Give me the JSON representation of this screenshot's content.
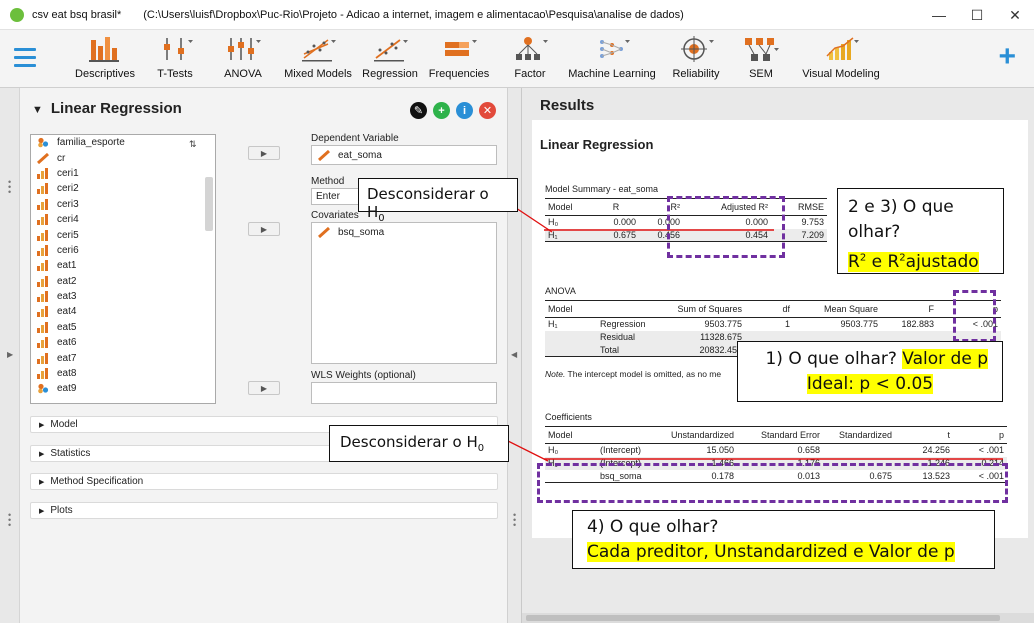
{
  "window": {
    "title": "csv eat bsq brasil*",
    "path": "(C:\\Users\\luisf\\Dropbox\\Puc-Rio\\Projeto - Adicao a internet, imagem e alimentacao\\Pesquisa\\analise de dados)"
  },
  "ribbon": {
    "items": [
      {
        "label": "Descriptives",
        "icon": "descriptives-icon"
      },
      {
        "label": "T-Tests",
        "icon": "ttests-icon"
      },
      {
        "label": "ANOVA",
        "icon": "anova-icon"
      },
      {
        "label": "Mixed Models",
        "icon": "mixed-models-icon"
      },
      {
        "label": "Regression",
        "icon": "regression-icon"
      },
      {
        "label": "Frequencies",
        "icon": "frequencies-icon"
      },
      {
        "label": "Factor",
        "icon": "factor-icon"
      },
      {
        "label": "Machine Learning",
        "icon": "machine-learning-icon"
      },
      {
        "label": "Reliability",
        "icon": "reliability-icon"
      },
      {
        "label": "SEM",
        "icon": "sem-icon"
      },
      {
        "label": "Visual Modeling",
        "icon": "visual-modeling-icon"
      }
    ]
  },
  "analysis": {
    "title": "Linear Regression",
    "variables": [
      "familia_esporte",
      "cr",
      "ceri1",
      "ceri2",
      "ceri3",
      "ceri4",
      "ceri5",
      "ceri6",
      "eat1",
      "eat2",
      "eat3",
      "eat4",
      "eat5",
      "eat6",
      "eat7",
      "eat8",
      "eat9"
    ],
    "dependent_label": "Dependent Variable",
    "dependent_value": "eat_soma",
    "method_label": "Method",
    "method_value": "Enter",
    "covariates_label": "Covariates",
    "covariates": [
      "bsq_soma"
    ],
    "wls_label": "WLS Weights (optional)",
    "sections": [
      "Model",
      "Statistics",
      "Method Specification",
      "Plots"
    ]
  },
  "results": {
    "header": "Results",
    "title": "Linear Regression",
    "summary": {
      "caption": "Model Summary - eat_soma",
      "columns": [
        "Model",
        "R",
        "R²",
        "Adjusted R²",
        "RMSE"
      ],
      "rows": [
        {
          "model": "H₀",
          "r": "0.000",
          "r2": "0.000",
          "adj": "0.000",
          "rmse": "9.753"
        },
        {
          "model": "H₁",
          "r": "0.675",
          "r2": "0.456",
          "adj": "0.454",
          "rmse": "7.209"
        }
      ]
    },
    "anova": {
      "caption": "ANOVA",
      "columns": [
        "Model",
        "",
        "Sum of Squares",
        "df",
        "Mean Square",
        "F",
        "p"
      ],
      "rows": [
        {
          "model": "H₁",
          "term": "Regression",
          "ss": "9503.775",
          "df": "1",
          "ms": "9503.775",
          "f": "182.883",
          "p": "< .001"
        },
        {
          "model": "",
          "term": "Residual",
          "ss": "11328.675",
          "df": "",
          "ms": "",
          "f": "",
          "p": ""
        },
        {
          "model": "",
          "term": "Total",
          "ss": "20832.450",
          "df": "",
          "ms": "",
          "f": "",
          "p": ""
        }
      ],
      "note_label": "Note.",
      "note_text": "The intercept model is omitted, as no me"
    },
    "coefficients": {
      "caption": "Coefficients",
      "columns": [
        "Model",
        "",
        "Unstandardized",
        "Standard Error",
        "Standardized",
        "t",
        "p"
      ],
      "rows": [
        {
          "model": "H₀",
          "term": "(Intercept)",
          "u": "15.050",
          "se": "0.658",
          "s": "",
          "t": "24.256",
          "p": "< .001"
        },
        {
          "model": "H₁",
          "term": "(Intercept)",
          "u": "1.466",
          "se": "1.176",
          "s": "",
          "t": "1.246",
          "p": "0.214"
        },
        {
          "model": "",
          "term": "bsq_soma",
          "u": "0.178",
          "se": "0.013",
          "s": "0.675",
          "t": "13.523",
          "p": "< .001"
        }
      ]
    }
  },
  "annotations": {
    "ignore_text": "Desconsiderar o H",
    "ignore_sub": "0",
    "q23_line1": "2 e 3) O que",
    "q23_line2": "olhar?",
    "q23_answer_r": "R",
    "q23_answer_sup": "2",
    "q23_answer_mid": " e R",
    "q23_answer_sup2": "2",
    "q23_answer_end": "ajustado",
    "q1_line1": "1) O que olhar?",
    "q1_highlight": "Valor de p",
    "q1_line2": "Ideal: p  < 0.05",
    "q4_line1": "4) O que olhar?",
    "q4_line2": "Cada preditor, Unstandardized e Valor de p"
  }
}
